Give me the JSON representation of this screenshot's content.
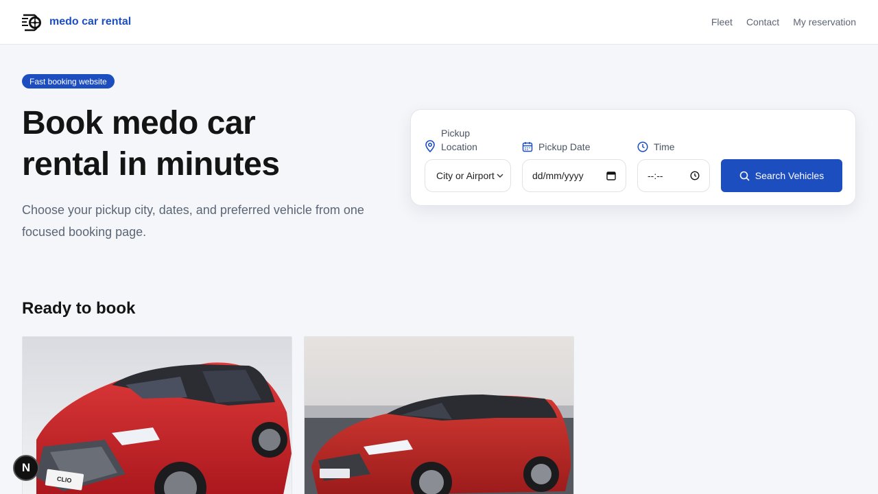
{
  "header": {
    "brand": "medo car rental",
    "nav": [
      "Fleet",
      "Contact",
      "My reservation"
    ]
  },
  "hero": {
    "badge": "Fast booking website",
    "title": "Book medo car rental in minutes",
    "subtitle": "Choose your pickup city, dates, and preferred vehicle from one focused booking page."
  },
  "booking": {
    "location_label": "Pickup Location",
    "location_value": "City or Airport",
    "date_label": "Pickup Date",
    "date_value": "dd/mm/yyyy",
    "time_label": "Time",
    "time_value": "--:--",
    "search_label": "Search Vehicles"
  },
  "section": {
    "title": "Ready to book"
  },
  "cars": [
    {
      "plate_text": "CLIO"
    },
    {
      "plate_text": ""
    }
  ],
  "fab": {
    "label": "N"
  },
  "colors": {
    "brand": "#1d4ec0",
    "background": "#f4f6f9",
    "car_red": "#c8262c"
  }
}
